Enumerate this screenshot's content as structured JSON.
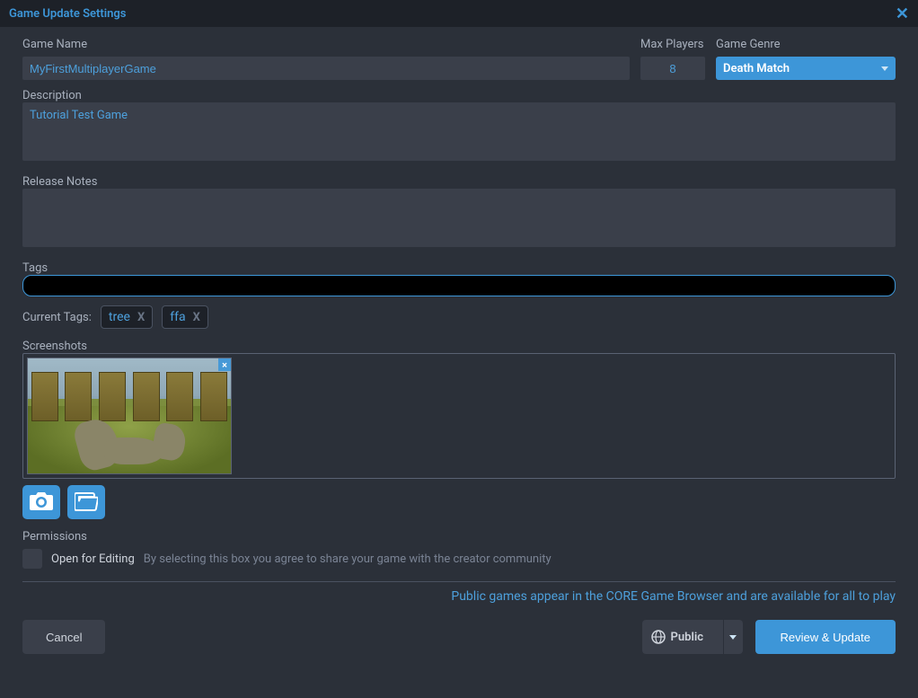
{
  "titlebar": {
    "title": "Game Update Settings",
    "close": "✕"
  },
  "fields": {
    "gameName": {
      "label": "Game Name",
      "value": "MyFirstMultiplayerGame"
    },
    "maxPlayers": {
      "label": "Max Players",
      "value": "8"
    },
    "genre": {
      "label": "Game Genre",
      "value": "Death Match"
    },
    "description": {
      "label": "Description",
      "value": "Tutorial Test Game"
    },
    "releaseNotes": {
      "label": "Release Notes",
      "value": ""
    },
    "tags": {
      "label": "Tags",
      "value": ""
    },
    "currentTagsLabel": "Current Tags:",
    "currentTags": [
      {
        "label": "tree"
      },
      {
        "label": "ffa"
      }
    ],
    "tagRemoveGlyph": "X",
    "screenshots": {
      "label": "Screenshots"
    },
    "permissions": {
      "label": "Permissions",
      "checkboxLabel": "Open for Editing",
      "checkboxDesc": "By selecting this box you agree to share your game with the creator community"
    }
  },
  "footer": {
    "infoText": "Public games appear in the CORE Game Browser and are available for all to play",
    "cancel": "Cancel",
    "visibility": "Public",
    "review": "Review & Update"
  }
}
